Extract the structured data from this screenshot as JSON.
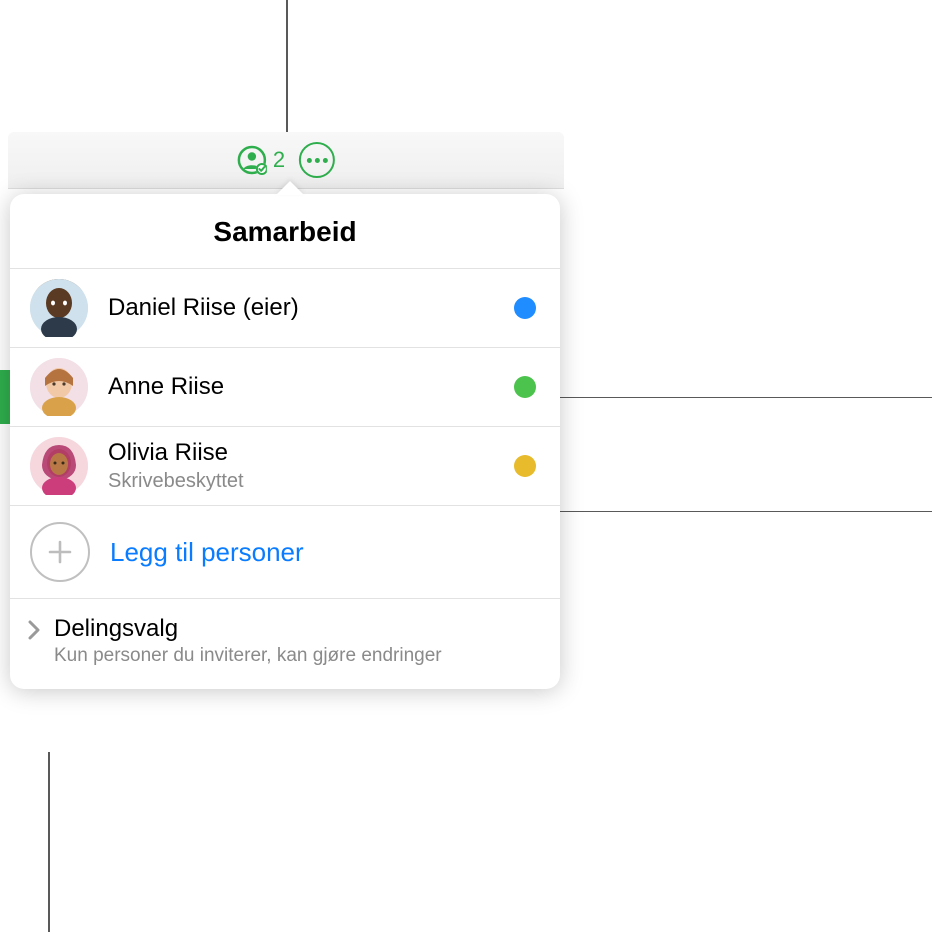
{
  "toolbar": {
    "collab_count": "2"
  },
  "popover": {
    "title": "Samarbeid",
    "people": [
      {
        "name": "Daniel Riise (eier)",
        "sub": "",
        "dot": "#1f8cff"
      },
      {
        "name": "Anne Riise",
        "sub": "",
        "dot": "#4cc34c"
      },
      {
        "name": "Olivia Riise",
        "sub": "Skrivebeskyttet",
        "dot": "#e7bb2b"
      }
    ],
    "add_label": "Legg til personer",
    "share_title": "Delingsvalg",
    "share_sub": "Kun personer du inviterer, kan gjøre endringer"
  },
  "colors": {
    "accent": "#2fae4d",
    "link": "#0a7cff"
  }
}
